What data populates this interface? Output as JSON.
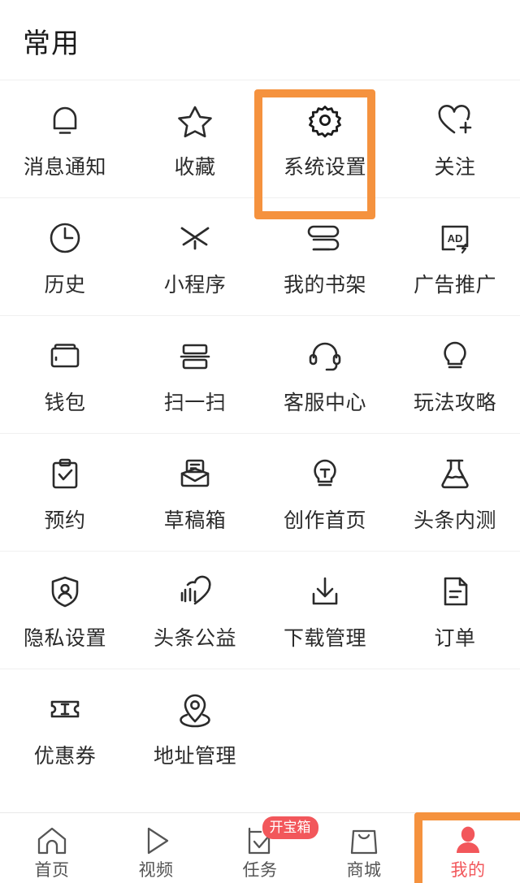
{
  "section": {
    "title": "常用"
  },
  "colors": {
    "highlight_orange": "#F5923E",
    "accent_red": "#F2575B",
    "icon_dark": "#2b2b2b",
    "label_dark": "#2b2b2b",
    "divider": "#f0f0f0",
    "tab_label": "#555555"
  },
  "grid": {
    "columns": 4,
    "highlighted_item": "系统设置",
    "rows": [
      [
        {
          "label": "消息通知",
          "icon": "bell-icon"
        },
        {
          "label": "收藏",
          "icon": "star-icon"
        },
        {
          "label": "系统设置",
          "icon": "gear-icon"
        },
        {
          "label": "关注",
          "icon": "heart-plus-icon"
        }
      ],
      [
        {
          "label": "历史",
          "icon": "clock-icon"
        },
        {
          "label": "小程序",
          "icon": "mini-program-icon"
        },
        {
          "label": "我的书架",
          "icon": "bookshelf-icon"
        },
        {
          "label": "广告推广",
          "icon": "ad-icon"
        }
      ],
      [
        {
          "label": "钱包",
          "icon": "wallet-icon"
        },
        {
          "label": "扫一扫",
          "icon": "scan-icon"
        },
        {
          "label": "客服中心",
          "icon": "headset-icon"
        },
        {
          "label": "玩法攻略",
          "icon": "lightbulb-icon"
        }
      ],
      [
        {
          "label": "预约",
          "icon": "clipboard-check-icon"
        },
        {
          "label": "草稿箱",
          "icon": "draft-inbox-icon"
        },
        {
          "label": "创作首页",
          "icon": "lightbulb-text-icon"
        },
        {
          "label": "头条内测",
          "icon": "flask-icon"
        }
      ],
      [
        {
          "label": "隐私设置",
          "icon": "shield-person-icon"
        },
        {
          "label": "头条公益",
          "icon": "charity-heart-icon"
        },
        {
          "label": "下载管理",
          "icon": "download-icon"
        },
        {
          "label": "订单",
          "icon": "document-icon"
        }
      ],
      [
        {
          "label": "优惠券",
          "icon": "coupon-icon"
        },
        {
          "label": "地址管理",
          "icon": "location-pin-icon"
        },
        {
          "label": "",
          "icon": ""
        },
        {
          "label": "",
          "icon": ""
        }
      ]
    ]
  },
  "tabbar": {
    "active_index": 4,
    "tabs": [
      {
        "label": "首页",
        "icon": "home-icon",
        "badge": ""
      },
      {
        "label": "视频",
        "icon": "play-icon",
        "badge": ""
      },
      {
        "label": "任务",
        "icon": "task-check-icon",
        "badge": "开宝箱"
      },
      {
        "label": "商城",
        "icon": "shopping-bag-icon",
        "badge": ""
      },
      {
        "label": "我的",
        "icon": "person-icon",
        "badge": ""
      }
    ]
  }
}
